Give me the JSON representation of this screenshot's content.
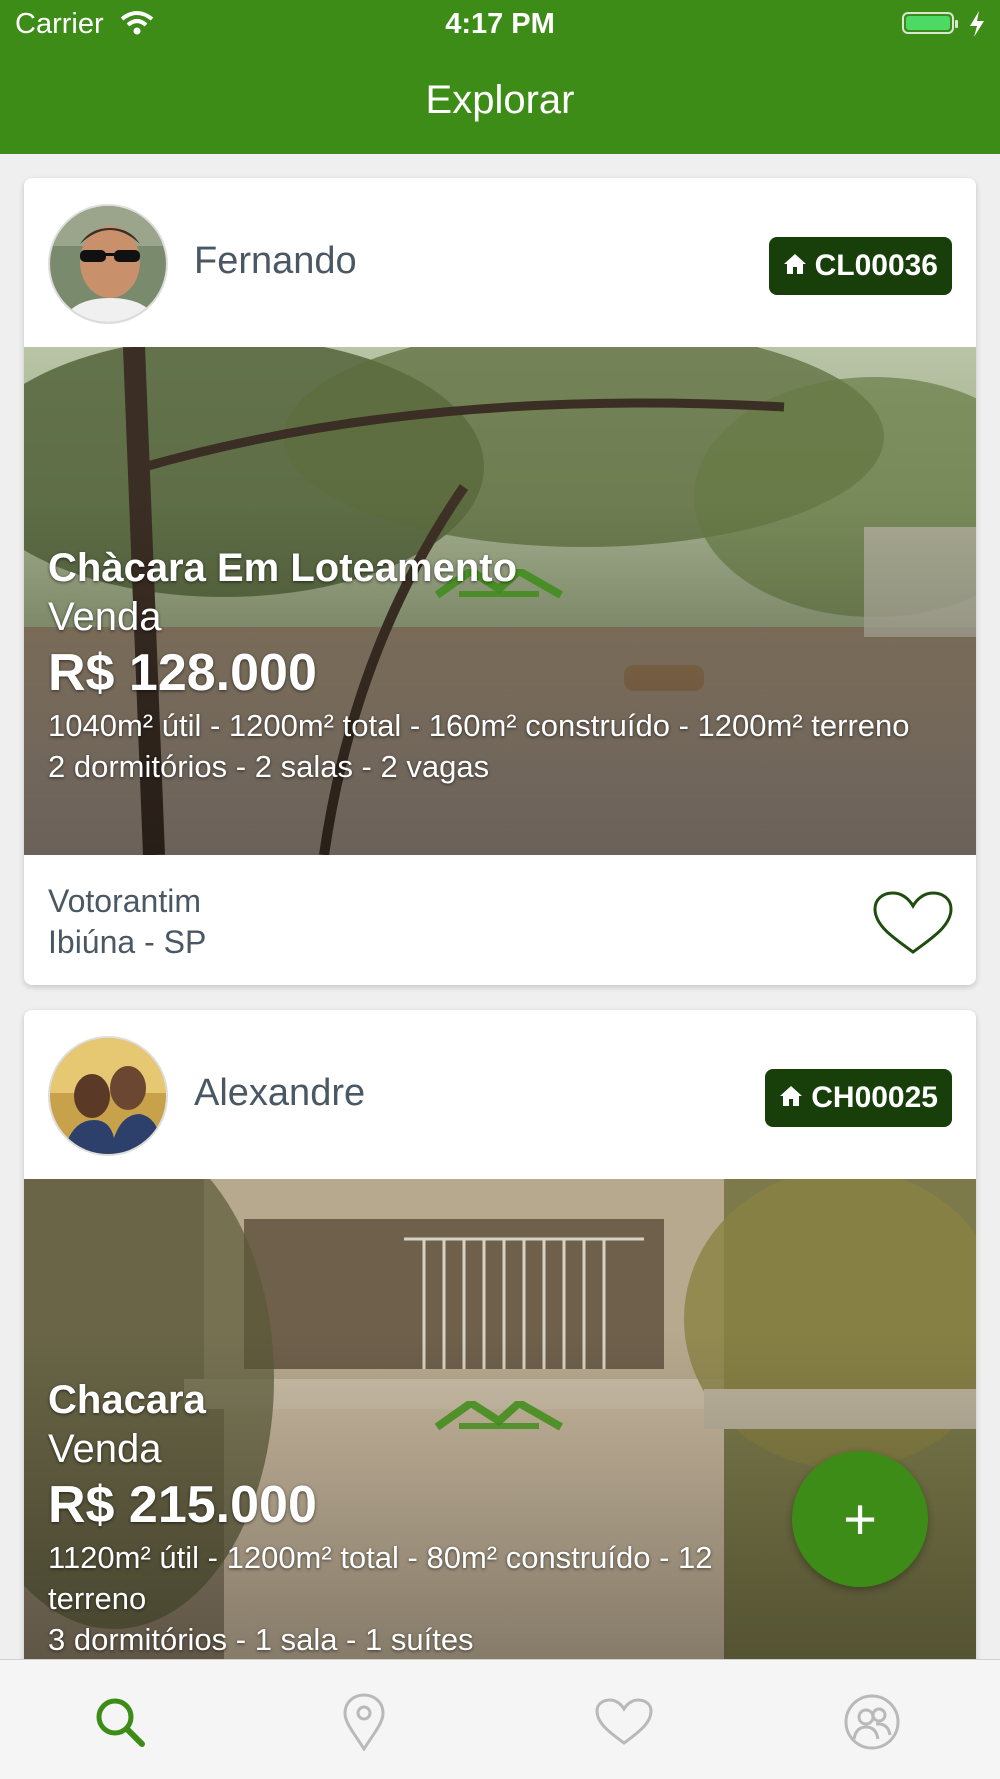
{
  "status_bar": {
    "carrier": "Carrier",
    "time": "4:17 PM"
  },
  "nav": {
    "title": "Explorar"
  },
  "listings": [
    {
      "agent": "Fernando",
      "code": "CL00036",
      "title": "Chàcara Em Loteamento",
      "type": "Venda",
      "price": "R$ 128.000",
      "areas": "1040m² útil - 1200m² total - 160m² construído - 1200m² terreno",
      "rooms": "2 dormitórios - 2 salas - 2 vagas",
      "neighborhood": "Votorantim",
      "city": "Ibiúna - SP"
    },
    {
      "agent": "Alexandre",
      "code": "CH00025",
      "title": "Chacara",
      "type": "Venda",
      "price": "R$ 215.000",
      "areas": "1120m² útil - 1200m² total - 80m² construído - 12",
      "areas_line2": "terreno",
      "rooms": "3 dormitórios - 1 sala - 1 suítes"
    }
  ],
  "fab": {
    "label": "+"
  },
  "tabs": [
    "search-icon",
    "location-pin-icon",
    "heart-icon",
    "contacts-icon"
  ],
  "colors": {
    "primary": "#3d8c17",
    "badge": "#183f0a",
    "text": "#4a5864"
  }
}
